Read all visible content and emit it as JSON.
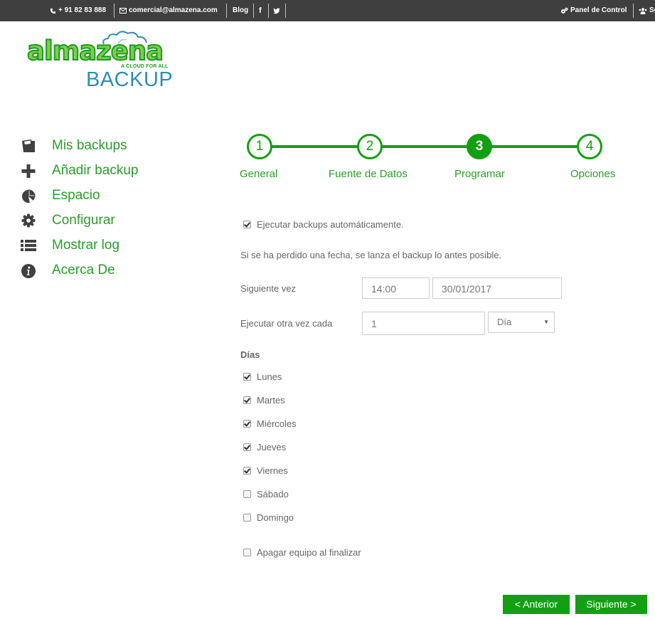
{
  "topbar": {
    "phone": "+ 91 82 83 888",
    "email": "comercial@almazena.com",
    "blog": "Blog",
    "facebook": "f",
    "panel": "Panel de Control",
    "user": "So"
  },
  "logo": {
    "brand": "almazena",
    "tagline": "A CLOUD FOR ALL",
    "product": "BACKUP"
  },
  "sidebar": {
    "items": [
      {
        "label": "Mis backups",
        "icon": "folder-icon"
      },
      {
        "label": "Añadir backup",
        "icon": "plus-icon"
      },
      {
        "label": "Espacio",
        "icon": "pie-chart-icon"
      },
      {
        "label": "Configurar",
        "icon": "gear-icon"
      },
      {
        "label": "Mostrar log",
        "icon": "list-icon"
      },
      {
        "label": "Acerca De",
        "icon": "info-icon"
      }
    ]
  },
  "stepper": {
    "steps": [
      {
        "num": "1",
        "label": "General"
      },
      {
        "num": "2",
        "label": "Fuente de Datos"
      },
      {
        "num": "3",
        "label": "Programar"
      },
      {
        "num": "4",
        "label": "Opciones"
      }
    ],
    "active": 3
  },
  "form": {
    "auto_label": "Ejecutar backups automáticamente.",
    "auto_checked": true,
    "info": "Si se ha perdido una fecha, se lanza el backup lo antes posible.",
    "next_label": "Siguiente vez",
    "next_time": "14:00",
    "next_date": "30/01/2017",
    "repeat_label": "Ejecutar otra vez cada",
    "repeat_value": "1",
    "repeat_unit": "Día",
    "days_title": "Días",
    "days": [
      {
        "label": "Lunes",
        "checked": true
      },
      {
        "label": "Martes",
        "checked": true
      },
      {
        "label": "Miércoles",
        "checked": true
      },
      {
        "label": "Jueves",
        "checked": true
      },
      {
        "label": "Viernes",
        "checked": true
      },
      {
        "label": "Sábado",
        "checked": false
      },
      {
        "label": "Domingo",
        "checked": false
      }
    ],
    "shutdown_label": "Apagar equipo al finalizar",
    "shutdown_checked": false
  },
  "buttons": {
    "prev": "< Anterior",
    "next": "Siguiente >"
  },
  "colors": {
    "accent": "#12a012",
    "topbar": "#3f3f3f",
    "logo_blue": "#2e8fb0"
  }
}
